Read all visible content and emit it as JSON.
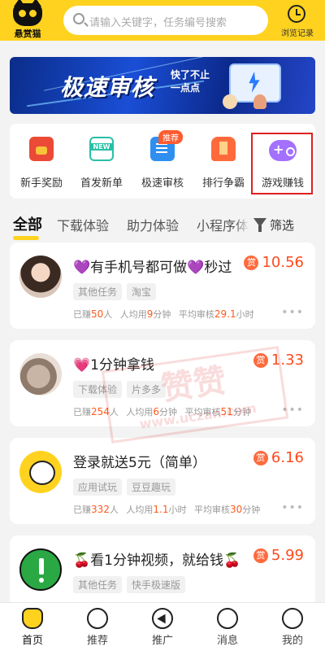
{
  "header": {
    "logo_text": "悬赏猫",
    "search_placeholder": "请输入关键字，任务编号搜索",
    "history_label": "浏览记录"
  },
  "banner": {
    "title": "极速审核",
    "subtitle": "快了不止一点点"
  },
  "categories": [
    {
      "label": "新手奖励",
      "icon": "red-envelope-icon"
    },
    {
      "label": "首发新单",
      "icon": "new-badge-icon"
    },
    {
      "label": "极速审核",
      "icon": "fast-review-icon",
      "badge": "推荐"
    },
    {
      "label": "排行争霸",
      "icon": "trophy-icon"
    },
    {
      "label": "游戏赚钱",
      "icon": "gamepad-icon"
    }
  ],
  "tabs": {
    "items": [
      "全部",
      "下载体验",
      "助力体验",
      "小程序体"
    ],
    "active_index": 0,
    "filter_label": "筛选"
  },
  "tasks": [
    {
      "title": "💜有手机号都可做💜秒过",
      "price": "10.56",
      "price_tag": "赏",
      "tags": [
        "其他任务",
        "淘宝"
      ],
      "earned_prefix": "已赚",
      "earned_count": "50",
      "earned_suffix": "人",
      "avg_time_prefix": "人均用",
      "avg_time_value": "9",
      "avg_time_unit": "分钟",
      "review_prefix": "平均审核",
      "review_value": "29.1",
      "review_unit": "小时"
    },
    {
      "title": "💗1分钟拿钱",
      "price": "1.33",
      "price_tag": "赏",
      "tags": [
        "下载体验",
        "片多多"
      ],
      "earned_prefix": "已赚",
      "earned_count": "254",
      "earned_suffix": "人",
      "avg_time_prefix": "人均用",
      "avg_time_value": "6",
      "avg_time_unit": "分钟",
      "review_prefix": "平均审核",
      "review_value": "51",
      "review_unit": "分钟"
    },
    {
      "title": "登录就送5元（简单）",
      "price": "6.16",
      "price_tag": "赏",
      "tags": [
        "应用试玩",
        "豆豆趣玩"
      ],
      "earned_prefix": "已赚",
      "earned_count": "332",
      "earned_suffix": "人",
      "avg_time_prefix": "人均用",
      "avg_time_value": "1.1",
      "avg_time_unit": "小时",
      "review_prefix": "平均审核",
      "review_value": "30",
      "review_unit": "分钟"
    },
    {
      "title": "🍒看1分钟视频，就给钱🍒",
      "price": "5.99",
      "price_tag": "赏",
      "tags": [
        "其他任务",
        "快手极速版"
      ]
    }
  ],
  "more_glyph": "•••",
  "watermark": {
    "text": "赞赞",
    "url": "www.uczan.com"
  },
  "bottom_nav": [
    {
      "label": "首页",
      "icon": "home-cat-icon"
    },
    {
      "label": "推荐",
      "icon": "recommend-icon"
    },
    {
      "label": "推广",
      "icon": "promote-icon"
    },
    {
      "label": "消息",
      "icon": "message-icon"
    },
    {
      "label": "我的",
      "icon": "profile-icon"
    }
  ],
  "colors": {
    "brand": "#ffd21f",
    "price": "#ff4a1c",
    "highlight": "#e02020"
  }
}
